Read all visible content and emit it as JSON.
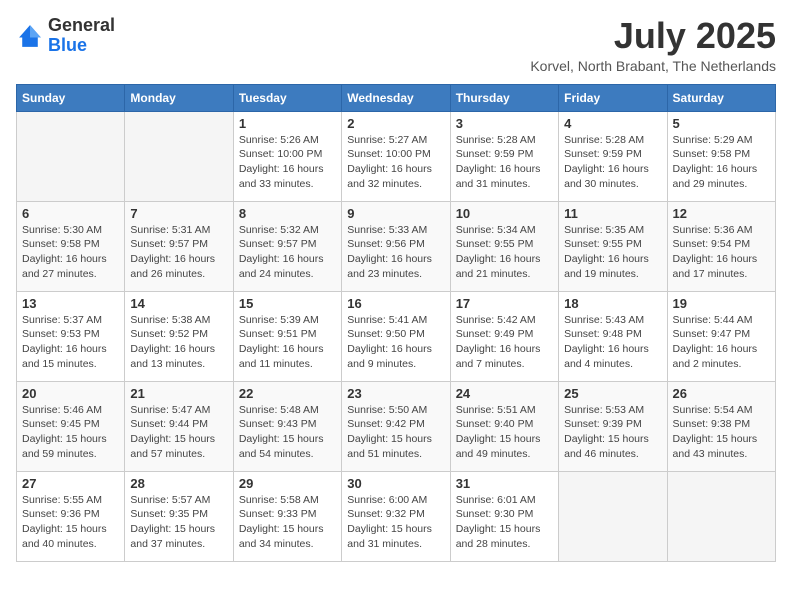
{
  "header": {
    "logo_general": "General",
    "logo_blue": "Blue",
    "month_title": "July 2025",
    "location": "Korvel, North Brabant, The Netherlands"
  },
  "weekdays": [
    "Sunday",
    "Monday",
    "Tuesday",
    "Wednesday",
    "Thursday",
    "Friday",
    "Saturday"
  ],
  "weeks": [
    [
      {
        "day": "",
        "info": ""
      },
      {
        "day": "",
        "info": ""
      },
      {
        "day": "1",
        "info": "Sunrise: 5:26 AM\nSunset: 10:00 PM\nDaylight: 16 hours and 33 minutes."
      },
      {
        "day": "2",
        "info": "Sunrise: 5:27 AM\nSunset: 10:00 PM\nDaylight: 16 hours and 32 minutes."
      },
      {
        "day": "3",
        "info": "Sunrise: 5:28 AM\nSunset: 9:59 PM\nDaylight: 16 hours and 31 minutes."
      },
      {
        "day": "4",
        "info": "Sunrise: 5:28 AM\nSunset: 9:59 PM\nDaylight: 16 hours and 30 minutes."
      },
      {
        "day": "5",
        "info": "Sunrise: 5:29 AM\nSunset: 9:58 PM\nDaylight: 16 hours and 29 minutes."
      }
    ],
    [
      {
        "day": "6",
        "info": "Sunrise: 5:30 AM\nSunset: 9:58 PM\nDaylight: 16 hours and 27 minutes."
      },
      {
        "day": "7",
        "info": "Sunrise: 5:31 AM\nSunset: 9:57 PM\nDaylight: 16 hours and 26 minutes."
      },
      {
        "day": "8",
        "info": "Sunrise: 5:32 AM\nSunset: 9:57 PM\nDaylight: 16 hours and 24 minutes."
      },
      {
        "day": "9",
        "info": "Sunrise: 5:33 AM\nSunset: 9:56 PM\nDaylight: 16 hours and 23 minutes."
      },
      {
        "day": "10",
        "info": "Sunrise: 5:34 AM\nSunset: 9:55 PM\nDaylight: 16 hours and 21 minutes."
      },
      {
        "day": "11",
        "info": "Sunrise: 5:35 AM\nSunset: 9:55 PM\nDaylight: 16 hours and 19 minutes."
      },
      {
        "day": "12",
        "info": "Sunrise: 5:36 AM\nSunset: 9:54 PM\nDaylight: 16 hours and 17 minutes."
      }
    ],
    [
      {
        "day": "13",
        "info": "Sunrise: 5:37 AM\nSunset: 9:53 PM\nDaylight: 16 hours and 15 minutes."
      },
      {
        "day": "14",
        "info": "Sunrise: 5:38 AM\nSunset: 9:52 PM\nDaylight: 16 hours and 13 minutes."
      },
      {
        "day": "15",
        "info": "Sunrise: 5:39 AM\nSunset: 9:51 PM\nDaylight: 16 hours and 11 minutes."
      },
      {
        "day": "16",
        "info": "Sunrise: 5:41 AM\nSunset: 9:50 PM\nDaylight: 16 hours and 9 minutes."
      },
      {
        "day": "17",
        "info": "Sunrise: 5:42 AM\nSunset: 9:49 PM\nDaylight: 16 hours and 7 minutes."
      },
      {
        "day": "18",
        "info": "Sunrise: 5:43 AM\nSunset: 9:48 PM\nDaylight: 16 hours and 4 minutes."
      },
      {
        "day": "19",
        "info": "Sunrise: 5:44 AM\nSunset: 9:47 PM\nDaylight: 16 hours and 2 minutes."
      }
    ],
    [
      {
        "day": "20",
        "info": "Sunrise: 5:46 AM\nSunset: 9:45 PM\nDaylight: 15 hours and 59 minutes."
      },
      {
        "day": "21",
        "info": "Sunrise: 5:47 AM\nSunset: 9:44 PM\nDaylight: 15 hours and 57 minutes."
      },
      {
        "day": "22",
        "info": "Sunrise: 5:48 AM\nSunset: 9:43 PM\nDaylight: 15 hours and 54 minutes."
      },
      {
        "day": "23",
        "info": "Sunrise: 5:50 AM\nSunset: 9:42 PM\nDaylight: 15 hours and 51 minutes."
      },
      {
        "day": "24",
        "info": "Sunrise: 5:51 AM\nSunset: 9:40 PM\nDaylight: 15 hours and 49 minutes."
      },
      {
        "day": "25",
        "info": "Sunrise: 5:53 AM\nSunset: 9:39 PM\nDaylight: 15 hours and 46 minutes."
      },
      {
        "day": "26",
        "info": "Sunrise: 5:54 AM\nSunset: 9:38 PM\nDaylight: 15 hours and 43 minutes."
      }
    ],
    [
      {
        "day": "27",
        "info": "Sunrise: 5:55 AM\nSunset: 9:36 PM\nDaylight: 15 hours and 40 minutes."
      },
      {
        "day": "28",
        "info": "Sunrise: 5:57 AM\nSunset: 9:35 PM\nDaylight: 15 hours and 37 minutes."
      },
      {
        "day": "29",
        "info": "Sunrise: 5:58 AM\nSunset: 9:33 PM\nDaylight: 15 hours and 34 minutes."
      },
      {
        "day": "30",
        "info": "Sunrise: 6:00 AM\nSunset: 9:32 PM\nDaylight: 15 hours and 31 minutes."
      },
      {
        "day": "31",
        "info": "Sunrise: 6:01 AM\nSunset: 9:30 PM\nDaylight: 15 hours and 28 minutes."
      },
      {
        "day": "",
        "info": ""
      },
      {
        "day": "",
        "info": ""
      }
    ]
  ]
}
